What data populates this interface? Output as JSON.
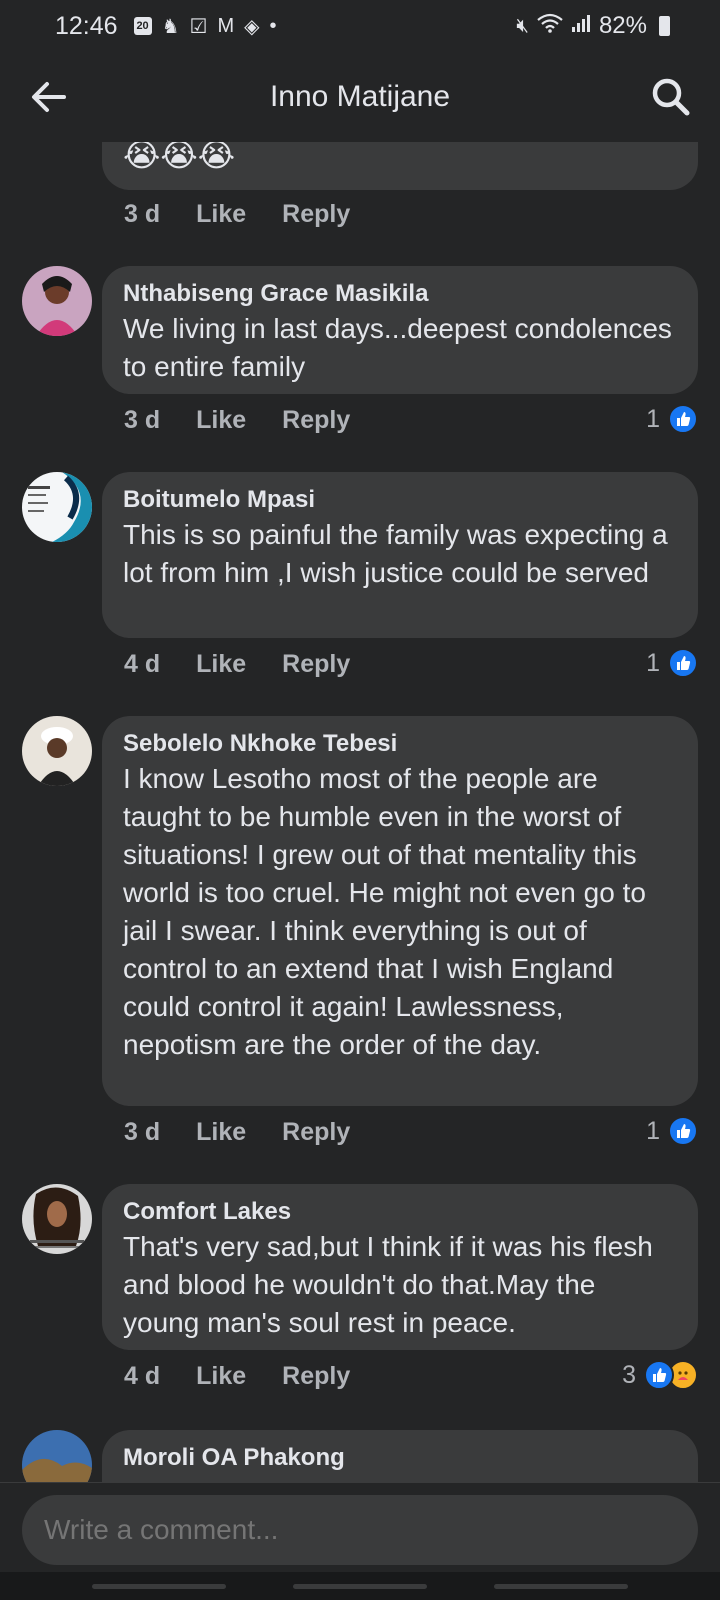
{
  "status_bar": {
    "time": "12:46",
    "calendar_badge": "20",
    "battery": "82%"
  },
  "header": {
    "title": "Inno Matijane"
  },
  "comments": [
    {
      "author": "",
      "text": "😭😭😭",
      "age": "3 d",
      "like_label": "Like",
      "reply_label": "Reply",
      "reactions": ""
    },
    {
      "author": "Nthabiseng Grace Masikila",
      "text": "We living in last days...deepest condolences to entire family",
      "age": "3 d",
      "like_label": "Like",
      "reply_label": "Reply",
      "reactions": "1"
    },
    {
      "author": "Boitumelo Mpasi",
      "text": "This is so painful the family was expecting a lot from him ,I wish justice could be served",
      "age": "4 d",
      "like_label": "Like",
      "reply_label": "Reply",
      "reactions": "1"
    },
    {
      "author": "Sebolelo Nkhoke Tebesi",
      "text": "I know Lesotho most of the people are taught to be humble even in the worst of situations! I grew out of that mentality this world is too cruel. He might not even go to jail I swear. I think everything is out of control to an extend that I wish England could control it again! Lawlessness, nepotism are the order of the day.",
      "age": "3 d",
      "like_label": "Like",
      "reply_label": "Reply",
      "reactions": "1"
    },
    {
      "author": "Comfort Lakes",
      "text": "That's very sad,but I think if it was his flesh and blood he wouldn't do that.May the young man's soul rest in peace.",
      "age": "4 d",
      "like_label": "Like",
      "reply_label": "Reply",
      "reactions": "3"
    },
    {
      "author": "Moroli OA Phakong",
      "text": "",
      "age": "",
      "like_label": "",
      "reply_label": "",
      "reactions": ""
    }
  ],
  "composer": {
    "placeholder": "Write a comment..."
  },
  "icons": {
    "back": "arrow-left-icon",
    "search": "search-icon",
    "like_reaction": "thumbs-up-icon",
    "care_reaction": "care-face-icon"
  },
  "colors": {
    "background": "#242526",
    "bubble": "#3a3b3c",
    "like_blue": "#1877f2",
    "text": "#e4e6eb",
    "secondary_text": "#b0b3b8"
  }
}
